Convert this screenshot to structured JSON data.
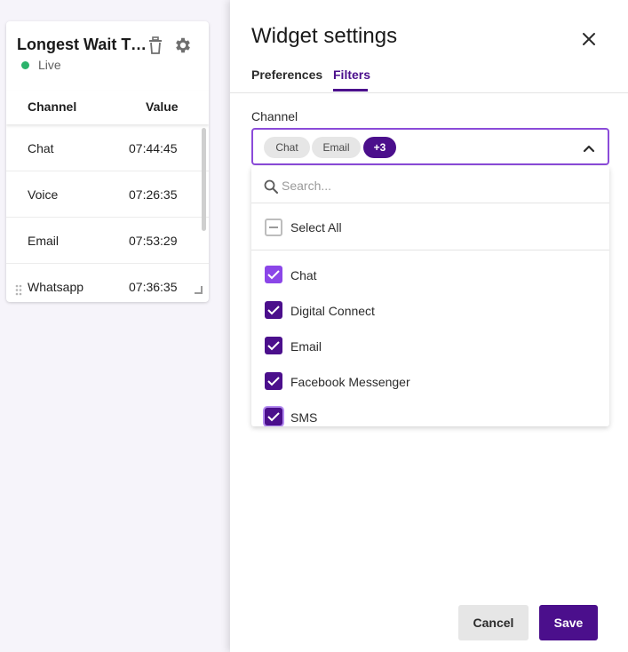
{
  "widget": {
    "title": "Longest Wait Ti...",
    "status": "Live",
    "columns": [
      "Channel",
      "Value"
    ],
    "rows": [
      {
        "channel": "Chat",
        "value": "07:44:45"
      },
      {
        "channel": "Voice",
        "value": "07:26:35"
      },
      {
        "channel": "Email",
        "value": "07:53:29"
      },
      {
        "channel": "Whatsapp",
        "value": "07:36:35"
      }
    ],
    "icons": {
      "delete": "trash-icon",
      "settings": "gear-icon",
      "drag": "drag-handle-icon",
      "resize": "resize-handle-icon"
    },
    "live_color": "#2bb36b"
  },
  "panel": {
    "title": "Widget settings",
    "tabs": [
      {
        "label": "Preferences",
        "active": false
      },
      {
        "label": "Filters",
        "active": true
      }
    ],
    "channel_filter": {
      "label": "Channel",
      "chips": [
        "Chat",
        "Email"
      ],
      "more_chip": "+3",
      "search_placeholder": "Search...",
      "select_all_label": "Select All",
      "options": [
        {
          "label": "Chat",
          "checked": true
        },
        {
          "label": "Digital Connect",
          "checked": true
        },
        {
          "label": "Email",
          "checked": true
        },
        {
          "label": "Facebook Messenger",
          "checked": true
        },
        {
          "label": "SMS",
          "checked": true
        }
      ]
    },
    "buttons": {
      "cancel": "Cancel",
      "save": "Save"
    },
    "accent_color": "#4b0f8c"
  }
}
